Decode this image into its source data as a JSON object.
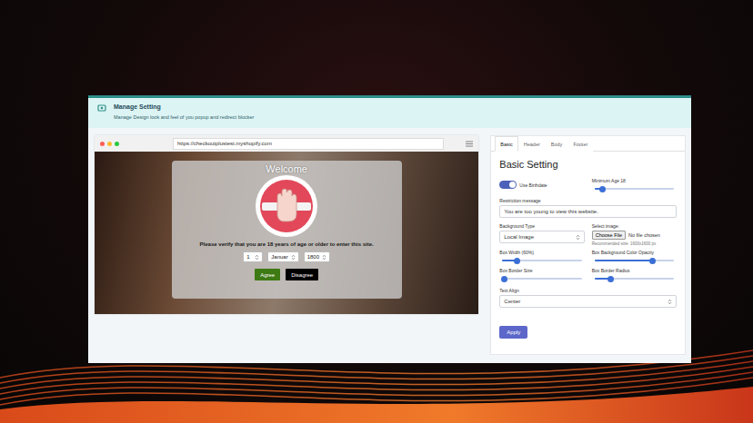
{
  "header": {
    "title": "Manage Setting",
    "subtitle": "Manage Design look and feel of you popup and redirect blocker"
  },
  "preview": {
    "url": "https://checkoutplustest.myshopify.com",
    "popup": {
      "title": "Welcome",
      "message": "Please verify that you are 18 years of age or older to enter this site.",
      "selects": [
        {
          "value": "1"
        },
        {
          "value": "Januar"
        },
        {
          "value": "1800"
        }
      ],
      "buttons": [
        {
          "label": "Agree",
          "color": "#3d7a14"
        },
        {
          "label": "Disagree",
          "color": "#000000"
        }
      ]
    }
  },
  "settings": {
    "tabs": [
      {
        "label": "Basic",
        "selected": true
      },
      {
        "label": "Header",
        "selected": false
      },
      {
        "label": "Body",
        "selected": false
      },
      {
        "label": "Footer",
        "selected": false
      }
    ],
    "title": "Basic Setting",
    "toggle": {
      "label": "Use Birthdate",
      "on": true
    },
    "min_age": {
      "label": "Minimum Age 18",
      "level": 0.1
    },
    "restriction": {
      "label": "Restriction message",
      "value": "You are too young to view this website."
    },
    "background_type": {
      "label": "Background Type",
      "value": "Local Image"
    },
    "image": {
      "label": "Select image:",
      "button": "Choose File",
      "status": "No file chosen",
      "hint": "Recommended size: 1600x1600 px"
    },
    "sliders": [
      {
        "label": "Box Width (60%)",
        "level": 0.18
      },
      {
        "label": "Box Background Color Opacity",
        "level": 0.73
      },
      {
        "label": "Box Border Size",
        "level": 0.03
      },
      {
        "label": "Box Border Radius",
        "level": 0.2
      }
    ],
    "text_align": {
      "label": "Text Align",
      "value": "Center"
    },
    "apply": "Apply"
  }
}
